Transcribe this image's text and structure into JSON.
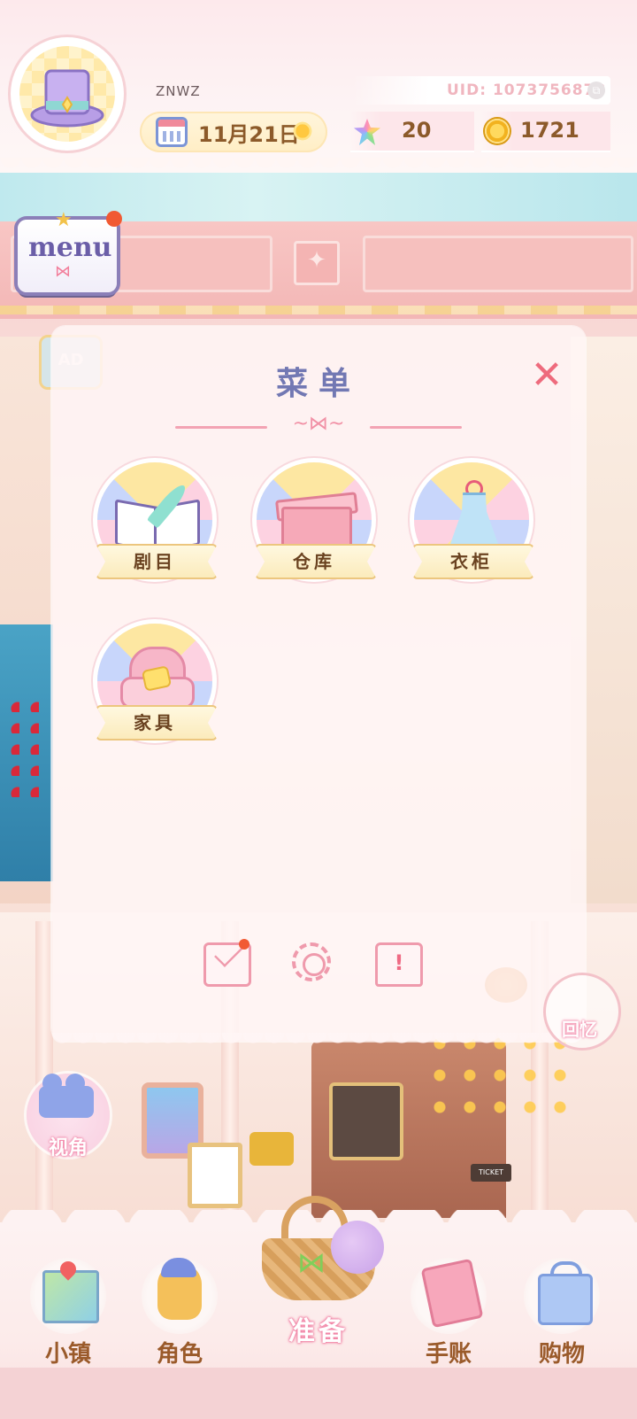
{
  "header": {
    "username": "ZNWZ",
    "uid_label": "UID: 1073756878",
    "date": "11月21日",
    "weather_icon": "sun-icon",
    "gems": "20",
    "coins": "1721"
  },
  "menu_button": {
    "label": "menu"
  },
  "side": {
    "ad_label": "AD",
    "camera_label": "视角",
    "memory_label": "回忆"
  },
  "panel": {
    "title": "菜单",
    "close_icon": "close-icon",
    "items": [
      {
        "label": "剧目",
        "icon": "script-book-icon"
      },
      {
        "label": "仓库",
        "icon": "storage-box-icon"
      },
      {
        "label": "衣柜",
        "icon": "wardrobe-dress-icon"
      },
      {
        "label": "家具",
        "icon": "furniture-armchair-icon"
      }
    ],
    "footer_icons": [
      "mail-icon",
      "settings-gear-icon",
      "notice-icon"
    ],
    "notice_glyph": "!"
  },
  "nav": {
    "items": [
      {
        "label": "小镇",
        "icon": "town-map-icon"
      },
      {
        "label": "角色",
        "icon": "character-icon"
      },
      {
        "label": "准备",
        "icon": "basket-icon"
      },
      {
        "label": "手账",
        "icon": "journal-icon"
      },
      {
        "label": "购物",
        "icon": "shopping-bag-icon"
      }
    ]
  },
  "colors": {
    "accent_pink": "#ef9aac",
    "title_purple": "#7278b3",
    "close_red": "#ee6b7d",
    "badge_red": "#f15a33",
    "nav_text": "#9a5a2a"
  }
}
